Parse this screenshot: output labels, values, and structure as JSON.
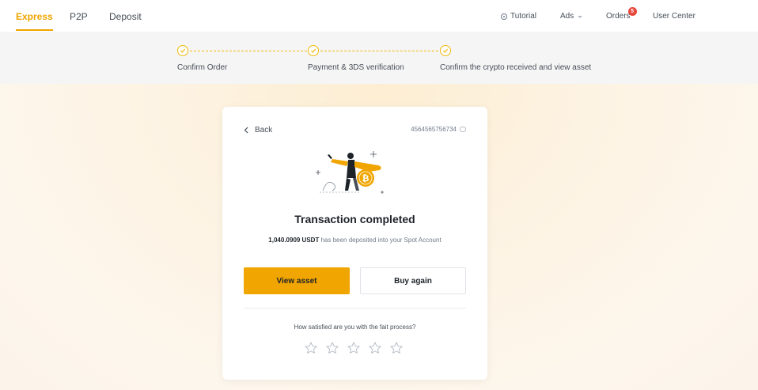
{
  "nav": {
    "tabs": [
      {
        "label": "Express",
        "active": true
      },
      {
        "label": "P2P",
        "active": false
      },
      {
        "label": "Deposit",
        "active": false
      }
    ],
    "right": {
      "tutorial": "Tutorial",
      "ads": "Ads",
      "orders": "Orders",
      "orders_badge": "5",
      "user_center": "User Center"
    }
  },
  "stepper": {
    "steps": [
      {
        "label": "Confirm Order",
        "status": "done"
      },
      {
        "label": "Payment & 3DS verification",
        "status": "done"
      },
      {
        "label": "Confirm the crypto received and view asset",
        "status": "done"
      }
    ]
  },
  "card": {
    "back_label": "Back",
    "order_id": "4564565756734",
    "title": "Transaction completed",
    "amount": "1,040.0909 USDT",
    "deposit_text": " has been deposited into your Spot Account",
    "primary_button": "View asset",
    "secondary_button": "Buy again",
    "rating_question": "How satisfied are you with the fait process?",
    "rating_stars": 5,
    "rating_value": 0
  },
  "colors": {
    "accent": "#f0a500",
    "brand_yellow": "#f0b90b",
    "badge_red": "#e8463a",
    "text_primary": "#1e2329",
    "text_secondary": "#707a8a"
  },
  "icons": [
    "clock-icon",
    "caret-down-icon",
    "check-circle-icon",
    "chevron-left-icon",
    "copy-icon",
    "star-icon"
  ]
}
